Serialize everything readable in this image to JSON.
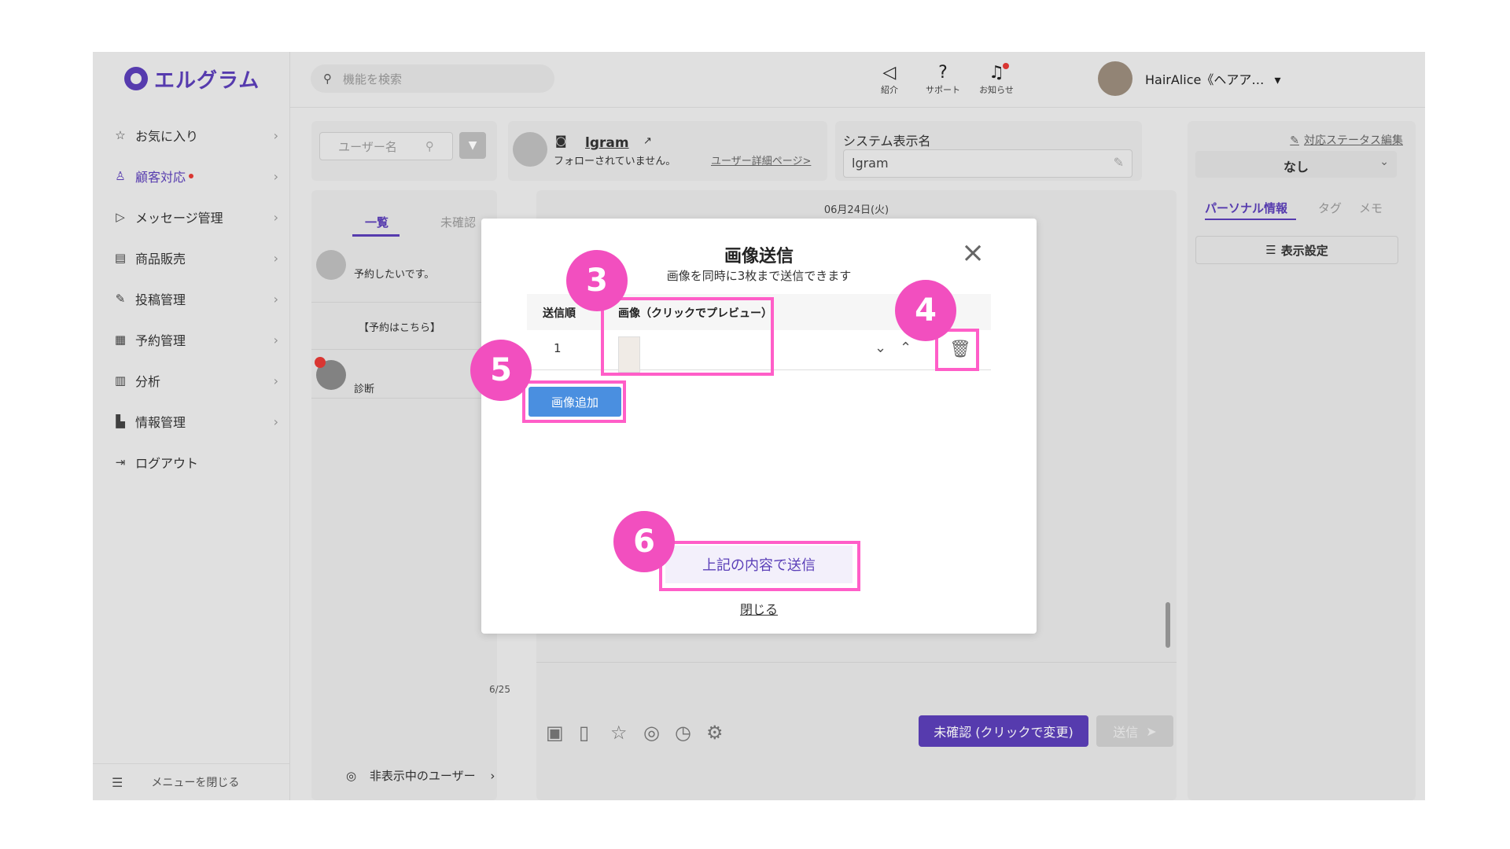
{
  "app": {
    "logo_text": "エルグラム"
  },
  "sidebar": {
    "items": [
      {
        "icon": "☆",
        "label": "お気に入り",
        "active": false
      },
      {
        "icon": "♙",
        "label": "顧客対応",
        "active": true
      },
      {
        "icon": "▷",
        "label": "メッセージ管理",
        "active": false
      },
      {
        "icon": "▤",
        "label": "商品販売",
        "active": false
      },
      {
        "icon": "✎",
        "label": "投稿管理",
        "active": false
      },
      {
        "icon": "▦",
        "label": "予約管理",
        "active": false
      },
      {
        "icon": "▥",
        "label": "分析",
        "active": false
      },
      {
        "icon": "▙",
        "label": "情報管理",
        "active": false
      },
      {
        "icon": "⇥",
        "label": "ログアウト",
        "active": false
      }
    ],
    "collapse_label": "メニューを閉じる"
  },
  "header": {
    "search_placeholder": "機能を検索",
    "icons": [
      {
        "name": "megaphone-icon",
        "glyph": "◁",
        "label": "紹介"
      },
      {
        "name": "help-icon",
        "glyph": "?",
        "label": "サポート"
      },
      {
        "name": "bell-icon",
        "glyph": "♫",
        "label": "お知らせ"
      }
    ],
    "user_name": "HairAlice《ヘアア…"
  },
  "user_list": {
    "search_placeholder": "ユーザー名",
    "tabs": [
      "一覧",
      "未確認"
    ],
    "rows": [
      "予約したいです。",
      "【予約はこちら】",
      "診断"
    ],
    "date_fragment": "6/25",
    "hidden_users_label": "非表示中のユーザー"
  },
  "chat": {
    "username": "lgram",
    "follow_status": "フォローされていません。",
    "detail_link": "ユーザー詳細ページ>",
    "date": "06月24日(火)",
    "unconfirmed_button": "未確認 (クリックで変更)",
    "send_button": "送信"
  },
  "system_name": {
    "label": "システム表示名",
    "value": "lgram"
  },
  "status_panel": {
    "edit_link": "対応ステータス編集",
    "status_value": "なし",
    "tabs": [
      "パーソナル情報",
      "タグ",
      "メモ"
    ],
    "display_settings": "表示設定"
  },
  "modal": {
    "title": "画像送信",
    "subtitle": "画像を同時に3枚まで送信できます",
    "col_order": "送信順",
    "col_image": "画像（クリックでプレビュー）",
    "row_order": "1",
    "add_button": "画像追加",
    "send_button": "上記の内容で送信",
    "close_link": "閉じる"
  },
  "callouts": [
    "3",
    "4",
    "5",
    "6"
  ],
  "colors": {
    "accent": "#5b3fb8",
    "highlight": "#ff5ec8",
    "badge": "#f24fbf",
    "add_button": "#4a8fe0"
  }
}
